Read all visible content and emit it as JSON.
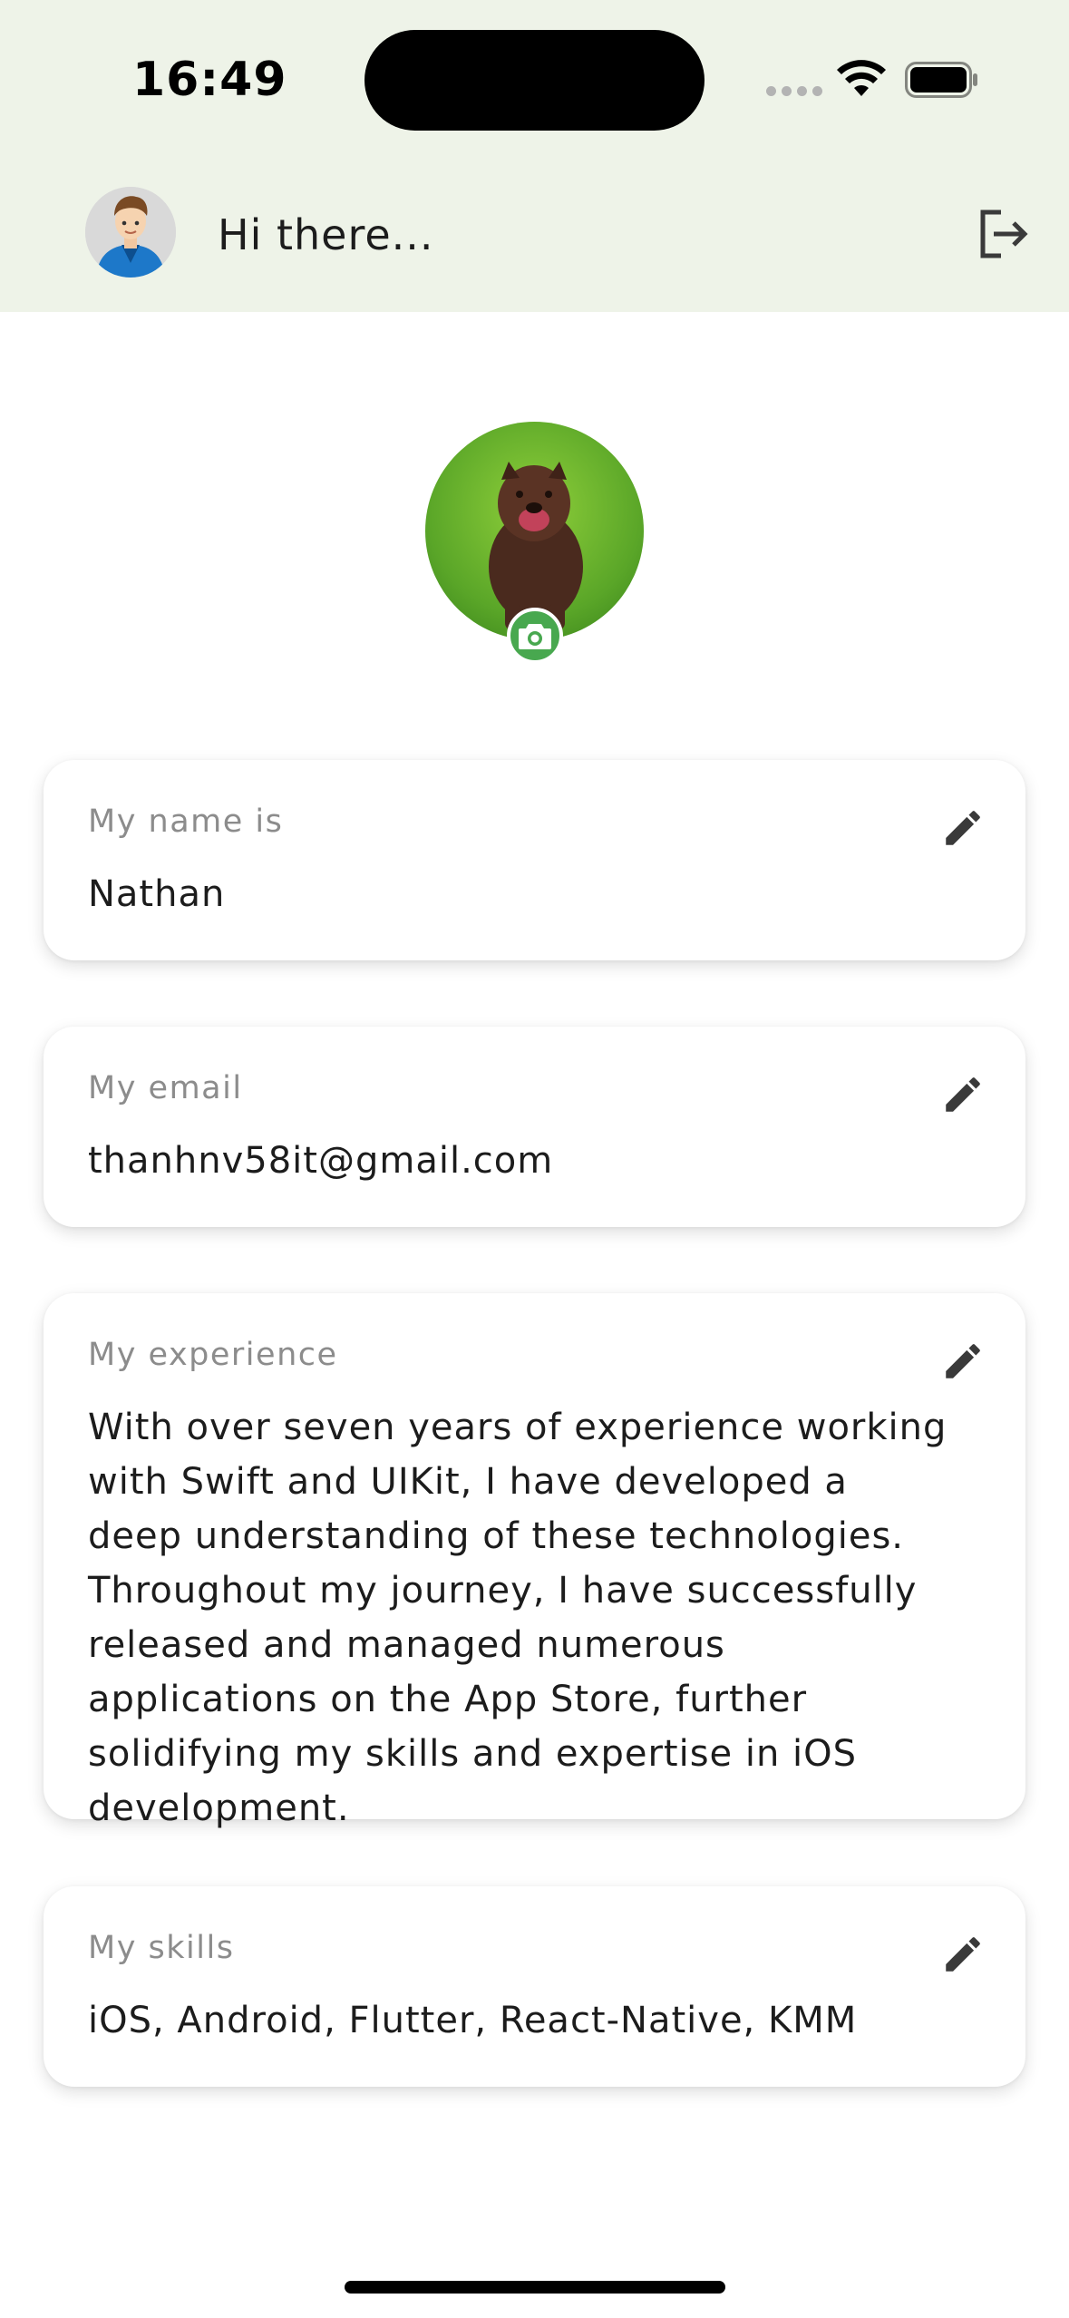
{
  "status_bar": {
    "time": "16:49",
    "icons": [
      "cellular-signal-icon",
      "wifi-icon",
      "battery-icon"
    ]
  },
  "header": {
    "greeting": "Hi there...",
    "avatar_icon": "user-avatar",
    "action_icon": "logout-icon"
  },
  "profile": {
    "photo": "dog-photo",
    "badge_icon": "camera-icon",
    "accent_color": "#48a84f"
  },
  "cards": [
    {
      "label": "My name is",
      "value": "Nathan",
      "action_icon": "edit-pencil-icon"
    },
    {
      "label": "My email",
      "value": "thanhnv58it@gmail.com",
      "action_icon": "edit-pencil-icon"
    },
    {
      "label": "My experience",
      "value": "With over seven years of experience working with Swift and UIKit, I have developed a deep understanding of these technologies. Throughout my journey, I have successfully released and managed numerous applications on the App Store, further solidifying my skills and expertise in iOS development.",
      "action_icon": "edit-pencil-icon"
    },
    {
      "label": "My skills",
      "value": "iOS, Android, Flutter, React-Native, KMM",
      "action_icon": "edit-pencil-icon"
    }
  ],
  "colors": {
    "header_bg": "#eef3e8",
    "text": "#1c1c1c",
    "label": "#8c8c8c",
    "icon": "#3a3a3a"
  }
}
